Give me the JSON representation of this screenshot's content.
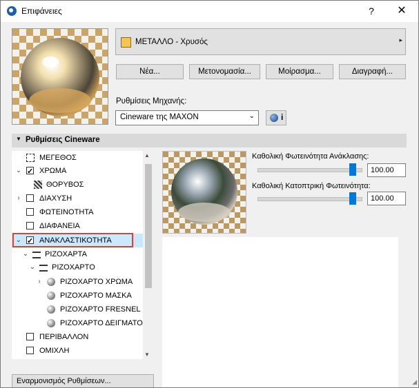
{
  "window": {
    "title": "Επιφάνειες",
    "help_label": "?",
    "close_label": "✕"
  },
  "material": {
    "name": "ΜΕΤΑΛΛΟ - Χρυσός",
    "swatch_color": "#f6c453",
    "menu_arrow": "▸"
  },
  "buttons": {
    "new": "Νέα...",
    "rename": "Μετονομασία...",
    "share": "Μοίρασμα...",
    "delete": "Διαγραφή..."
  },
  "engine": {
    "label": "Ρυθμίσεις Μηχανής:",
    "value": "Cineware της MAXON",
    "info_label": "i"
  },
  "section": {
    "title": "Ρυθμίσεις Cineware"
  },
  "tree": [
    {
      "label": "ΜΕΓΕΘΟΣ",
      "icon": "size-icon"
    },
    {
      "label": "ΧΡΩΜΑ",
      "checked": true,
      "expanded": true
    },
    {
      "label": "ΘΟΡΥΒΟΣ",
      "icon": "noise-icon"
    },
    {
      "label": "ΔΙΑΧΥΣΗ",
      "checked": false,
      "expanded": false
    },
    {
      "label": "ΦΩΤΕΙΝΟΤΗΤΑ",
      "checked": false
    },
    {
      "label": "ΔΙΑΦΑΝΕΙΑ",
      "checked": false
    },
    {
      "label": "ΑΝΑΚΛΑΣΤΙΚΟΤΗΤΑ",
      "checked": true,
      "expanded": true,
      "selected": true
    },
    {
      "label": "ΡΙΖΟΧΑΡΤΑ",
      "icon": "layers-icon",
      "expanded": true
    },
    {
      "label": "ΡΙΖΟΧΑΡΤΟ",
      "icon": "layer-icon",
      "expanded": true
    },
    {
      "label": "ΡΙΖΟΧΑΡΤΟ ΧΡΩΜΑ",
      "icon": "sphere-icon",
      "expanded": false
    },
    {
      "label": "ΡΙΖΟΧΑΡΤΟ ΜΑΣΚΑ",
      "icon": "sphere-icon"
    },
    {
      "label": "ΡΙΖΟΧΑΡΤΟ FRESNEL",
      "icon": "sphere-icon"
    },
    {
      "label": "ΡΙΖΟΧΑΡΤΟ ΔΕΙΓΜΑΤΟΛ",
      "icon": "sphere-icon"
    },
    {
      "label": "ΠΕΡΙΒΑΛΛΟΝ",
      "checked": false
    },
    {
      "label": "ΟΜΙΧΛΗ",
      "checked": false
    }
  ],
  "params": {
    "refl_label": "Καθολική Φωτεινότητα Ανάκλασης:",
    "refl_value": "100.00",
    "refl_level": 0.91,
    "spec_label": "Καθολική Κατοπτρική Φωτεινότητα:",
    "spec_value": "100.00",
    "spec_level": 0.91
  },
  "bottom": {
    "match_label": "Εναρμονισμός Ρυθμίσεων..."
  },
  "colors": {
    "accent": "#0078d7",
    "highlight": "#d9432f",
    "selection": "#cce8ff"
  }
}
